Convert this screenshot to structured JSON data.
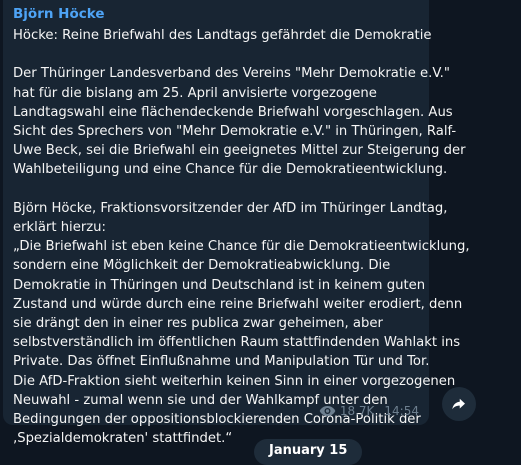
{
  "post": {
    "sender": "Björn Höcke",
    "lines": [
      "Höcke: Reine Briefwahl des Landtags gefährdet die Demokratie",
      "",
      "Der Thüringer Landesverband des Vereins \"Mehr Demokratie e.V.\"",
      "hat für die bislang am 25. April anvisierte vorgezogene",
      "Landtagswahl eine flächendeckende Briefwahl vorgeschlagen. Aus",
      "Sicht des Sprechers von \"Mehr Demokratie e.V.\" in Thüringen, Ralf-",
      "Uwe Beck, sei die Briefwahl ein geeignetes Mittel zur Steigerung der",
      "Wahlbeteiligung und eine Chance für die Demokratieentwicklung.",
      "",
      "Björn Höcke, Fraktionsvorsitzender der AfD im Thüringer Landtag,",
      "erklärt hierzu:",
      "„Die Briefwahl ist eben keine Chance für die Demokratieentwicklung,",
      "sondern eine Möglichkeit der Demokratieabwicklung. Die",
      "Demokratie in Thüringen und Deutschland ist in keinem guten",
      "Zustand und würde durch eine reine Briefwahl weiter erodiert, denn",
      "sie drängt den in einer res publica zwar geheimen, aber",
      "selbstverständlich im öffentlichen Raum stattfindenden Wahlakt ins",
      "Private. Das öffnet Einflußnahme und Manipulation Tür und Tor.",
      "Die AfD-Fraktion sieht weiterhin keinen Sinn in einer vorgezogenen",
      "Neuwahl - zumal wenn sie und der Wahlkampf unter den",
      "Bedingungen der oppositionsblockierenden Corona-Politik der",
      "‚Spezialdemokraten' stattfindet.“"
    ],
    "views": "18.7K",
    "time": "14:54",
    "view_icon": "eye-icon",
    "share_icon": "share-arrow-icon"
  },
  "date_separator": "January 15",
  "colors": {
    "background": "#0e1621",
    "bubble": "#182533",
    "sender_name": "#4ea4f6",
    "text": "#f5f5f5",
    "meta": "#6d7f8f",
    "pill": "#1e2c3a"
  }
}
